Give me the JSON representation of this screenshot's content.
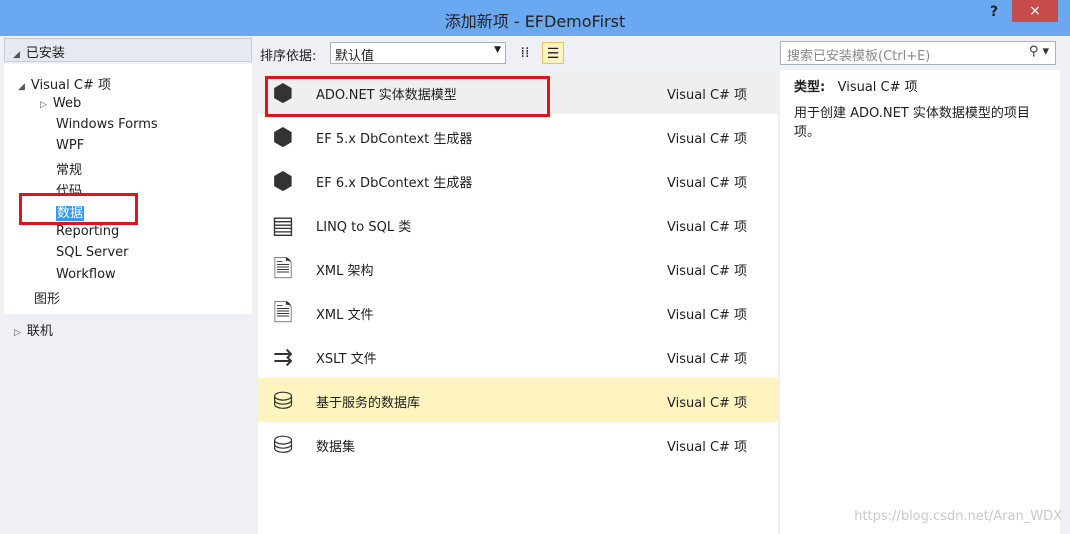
{
  "window": {
    "title": "添加新项 - EFDemoFirst",
    "help": "?",
    "close": "×"
  },
  "left": {
    "installed": "已安装",
    "tree": [
      {
        "label": "Visual C# 项",
        "expanded": true
      },
      {
        "label": "Web"
      },
      {
        "label": "Windows Forms"
      },
      {
        "label": "WPF"
      },
      {
        "label": "常规"
      },
      {
        "label": "代码"
      },
      {
        "label": "数据",
        "selected": true
      },
      {
        "label": "Reporting"
      },
      {
        "label": "SQL Server"
      },
      {
        "label": "Workflow"
      },
      {
        "label": "图形"
      }
    ],
    "online": "联机"
  },
  "toolbar": {
    "sort_label": "排序依据:",
    "sort_value": "默认值",
    "search_placeholder": "搜索已安装模板(Ctrl+E)"
  },
  "items": [
    {
      "name": "ADO.NET 实体数据模型",
      "type": "Visual C# 项",
      "icon": "entity-model-icon",
      "selected": true
    },
    {
      "name": "EF 5.x DbContext 生成器",
      "type": "Visual C# 项",
      "icon": "entity-model-icon"
    },
    {
      "name": "EF 6.x DbContext 生成器",
      "type": "Visual C# 项",
      "icon": "entity-model-icon"
    },
    {
      "name": "LINQ to SQL 类",
      "type": "Visual C# 项",
      "icon": "linq-icon"
    },
    {
      "name": "XML 架构",
      "type": "Visual C# 项",
      "icon": "xml-file-icon"
    },
    {
      "name": "XML 文件",
      "type": "Visual C# 项",
      "icon": "xml-file-icon"
    },
    {
      "name": "XSLT 文件",
      "type": "Visual C# 项",
      "icon": "xslt-icon"
    },
    {
      "name": "基于服务的数据库",
      "type": "Visual C# 项",
      "icon": "database-icon",
      "hover": true
    },
    {
      "name": "数据集",
      "type": "Visual C# 项",
      "icon": "dataset-icon"
    }
  ],
  "detail": {
    "type_label": "类型:",
    "type_value": "Visual C# 项",
    "description": "用于创建 ADO.NET 实体数据模型的项目项。"
  },
  "watermark": "https://blog.csdn.net/Aran_WDX",
  "colors": {
    "titlebar": "#6aa9f2",
    "selection": "#3399ff",
    "highlight": "#fdf4bf",
    "annotation": "#e0141e"
  }
}
